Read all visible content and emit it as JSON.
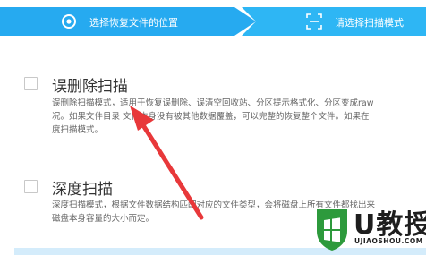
{
  "stepper": {
    "step1_label": "选择恢复文件的位置",
    "step2_label": "请选择扫描模式",
    "step1_color": "#26aaf0",
    "step2_color": "#2eb6f4",
    "step1_icon": "target-icon",
    "step2_icon": "scan-icon"
  },
  "options": [
    {
      "title": "误删除扫描",
      "desc_lines": [
        "误删除扫描模式，适用于恢复误删除、误清空回收站、分区提示格式化、分区变成raw",
        "况。如果文件目录                   文件本身没有被其他数据覆盖，可以完整的恢复整个文件。如果在",
        "度扫描模式。"
      ]
    },
    {
      "title": "深度扫描",
      "desc_lines": [
        "深度扫描模式，根据文件数据结构匹配对应的文件类型，会将磁盘上所有文件都找出来",
        "磁盘本身容量的大小而定。"
      ]
    }
  ],
  "annotation": {
    "arrow_color": "#e8383a",
    "icon": "red-arrow-icon"
  },
  "watermark": {
    "text": "U教授",
    "url": "UJIAOSHOU.COM",
    "icon": "windows-shield-icon",
    "shield_color": "#2d9a3c"
  }
}
